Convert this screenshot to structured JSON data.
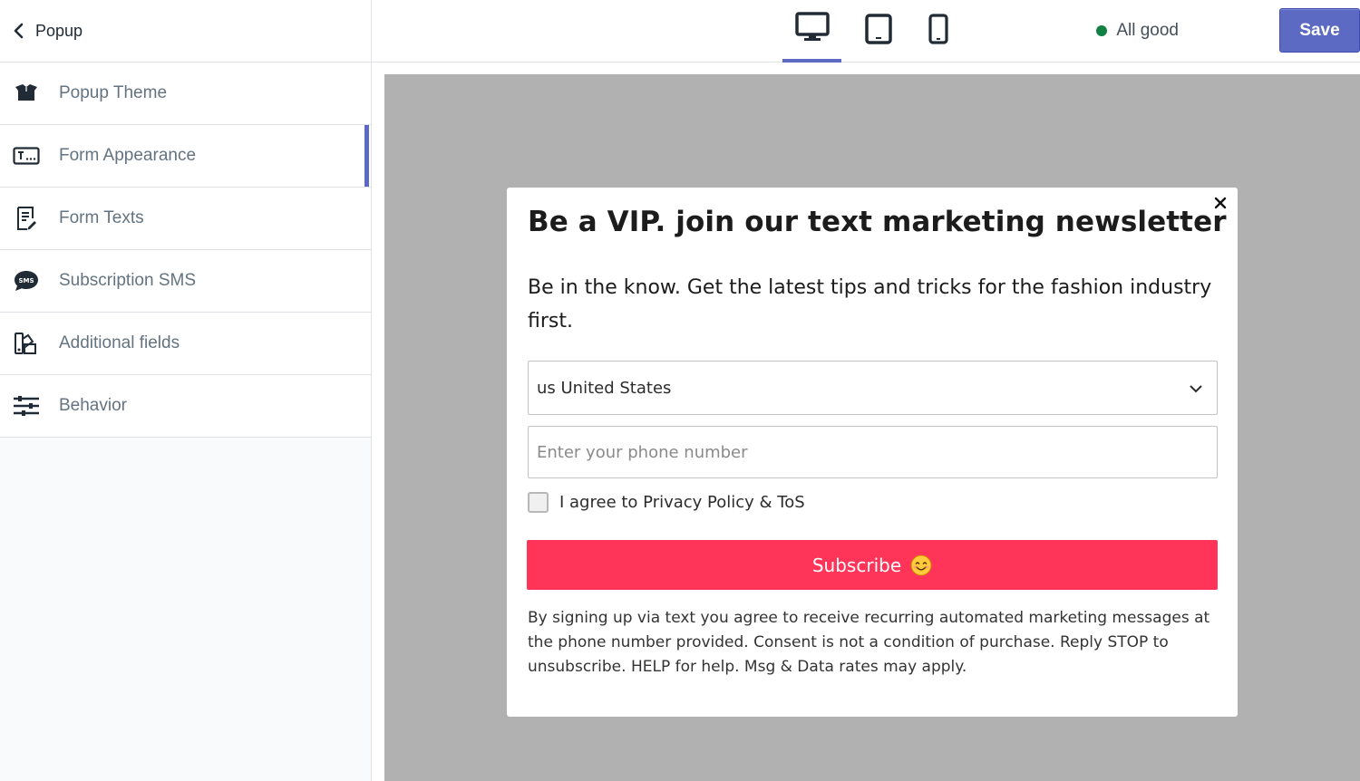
{
  "sidebar": {
    "back_label": "Popup",
    "items": [
      {
        "label": "Popup Theme",
        "icon": "box-icon",
        "active": false
      },
      {
        "label": "Form Appearance",
        "icon": "text-field-icon",
        "active": true
      },
      {
        "label": "Form Texts",
        "icon": "document-edit-icon",
        "active": false
      },
      {
        "label": "Subscription SMS",
        "icon": "sms-bubble-icon",
        "active": false
      },
      {
        "label": "Additional fields",
        "icon": "shapes-icon",
        "active": false
      },
      {
        "label": "Behavior",
        "icon": "sliders-icon",
        "active": false
      }
    ]
  },
  "topbar": {
    "devices": [
      {
        "name": "desktop",
        "icon": "desktop-icon",
        "active": true
      },
      {
        "name": "tablet",
        "icon": "tablet-icon",
        "active": false
      },
      {
        "name": "mobile",
        "icon": "mobile-icon",
        "active": false
      }
    ],
    "status_text": "All good",
    "status_color": "#108043",
    "save_label": "Save"
  },
  "popup": {
    "title": "Be a VIP. join our text marketing newsletter",
    "subtitle": "Be in the know. Get the latest tips and tricks for the fashion industry first.",
    "country_selected": "us United States",
    "phone_placeholder": "Enter your phone number",
    "agree_label": "I agree to Privacy Policy & ToS",
    "subscribe_label": "Subscribe",
    "subscribe_emoji": "smiling-face-icon",
    "disclaimer": "By signing up via text you agree to receive recurring automated marketing messages at the phone number provided. Consent is not a condition of purchase. Reply STOP to unsubscribe. HELP for help. Msg & Data rates may apply."
  },
  "colors": {
    "accent": "#5c6ac4",
    "subscribe": "#ff3458",
    "preview_bg": "#b1b1b1"
  }
}
